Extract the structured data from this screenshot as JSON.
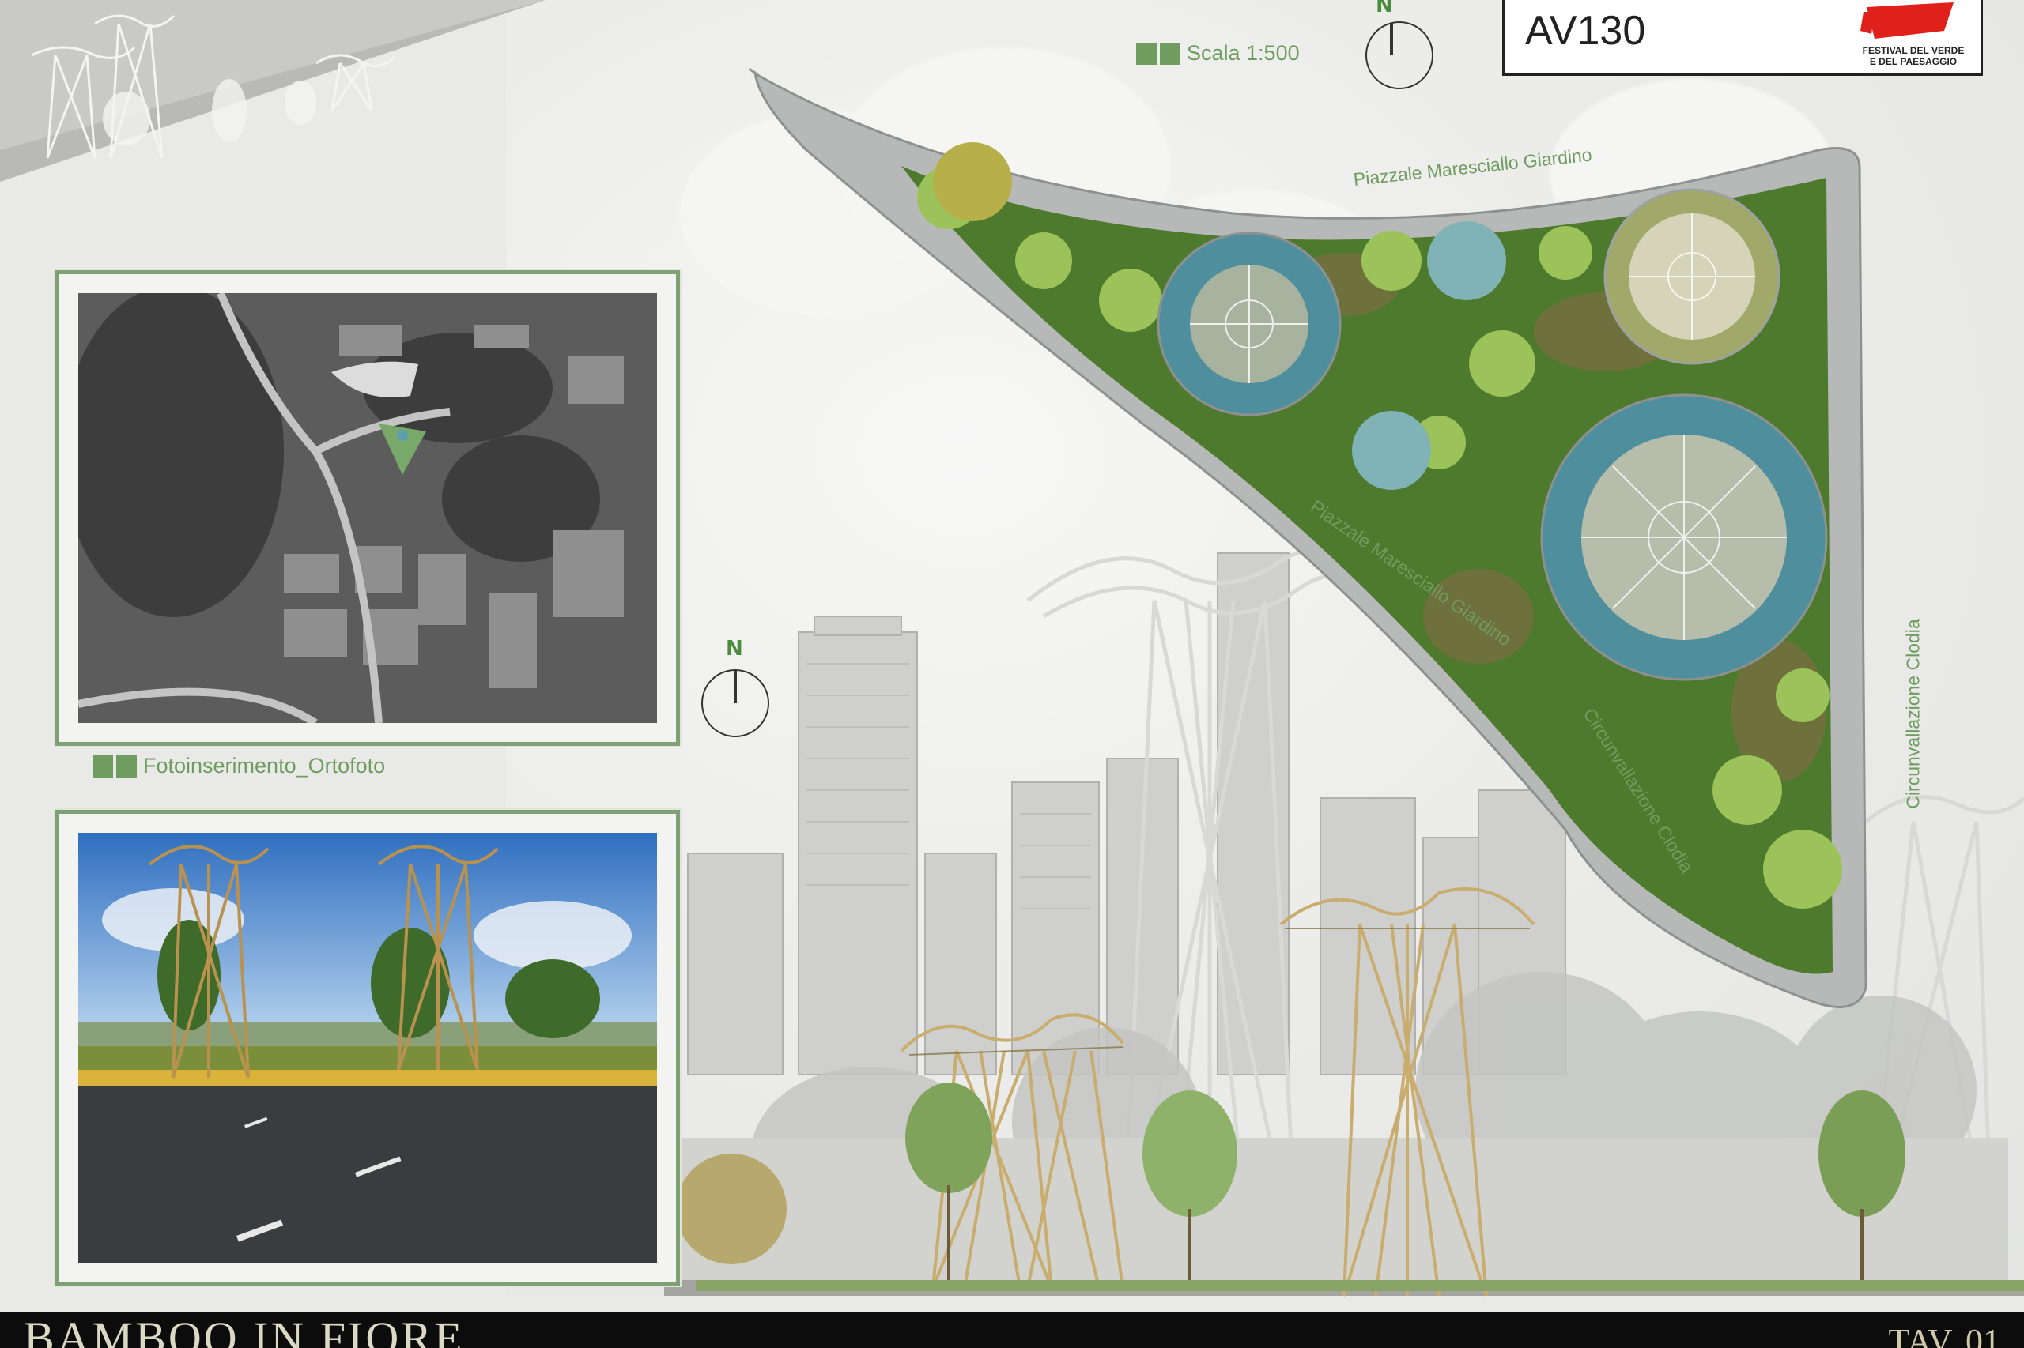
{
  "board": {
    "code": "AV130",
    "scale_label": "Scala 1:500",
    "ortho_label": "Fotoinserimento_Ortofoto",
    "festival_line1": "FESTIVAL DEL VERDE",
    "festival_line2": "E DEL PAESAGGIO",
    "north_letter": "N",
    "title": "BAMBOO IN FIORE",
    "sheet": "TAV. 01"
  },
  "streets": {
    "top": "Piazzale Maresciallo Giardino",
    "diagonal": "Piazzale Maresciallo Giardino",
    "lower_diagonal": "Circunvallazione Clodia",
    "right": "Circunvallazione Clodia"
  },
  "colors": {
    "accent_green": "#6f9c5f",
    "frame_green": "#7ea074",
    "brand_red": "#e0201b",
    "water": "#5f9aa8",
    "bamboo": "#c9ad6e",
    "footer": "#0c0c0c"
  }
}
